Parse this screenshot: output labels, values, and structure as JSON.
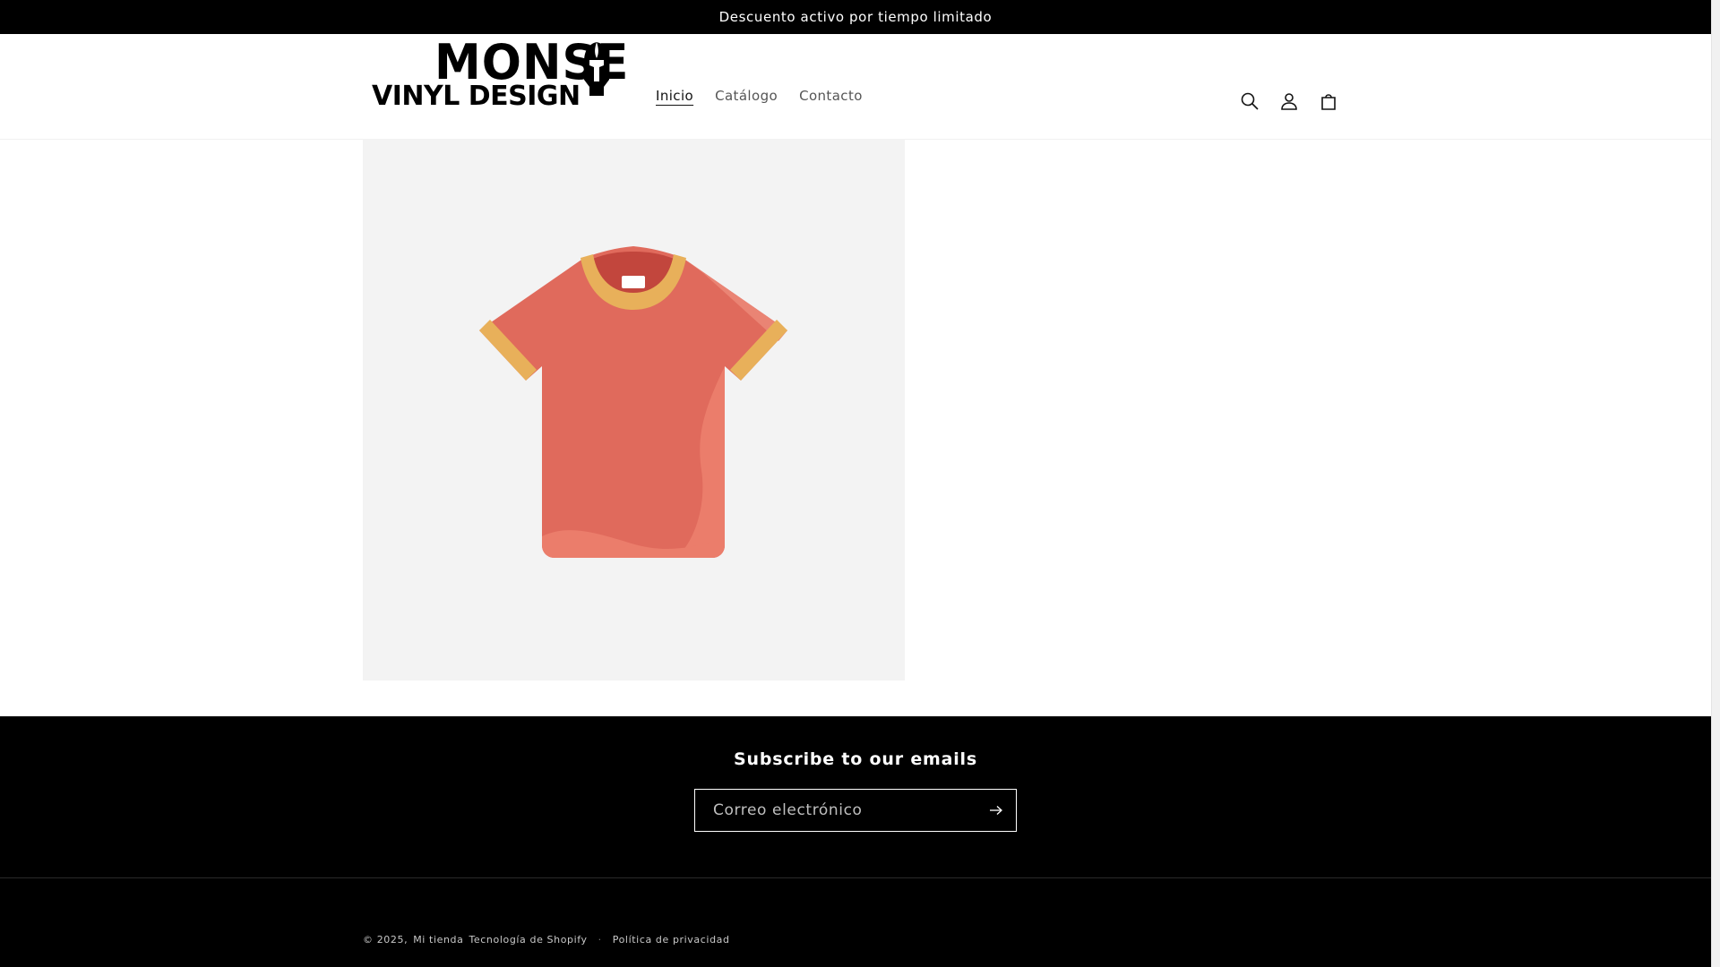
{
  "announcement": {
    "text": "Descuento activo por tiempo limitado"
  },
  "header": {
    "logo": {
      "line1": "MONSE",
      "line2": "VINYL DESIGN"
    },
    "nav": [
      {
        "label": "Inicio",
        "active": true
      },
      {
        "label": "Catálogo",
        "active": false
      },
      {
        "label": "Contacto",
        "active": false
      }
    ],
    "icons": [
      "search-icon",
      "account-icon",
      "cart-icon"
    ]
  },
  "product": {
    "image_icon": "t-shirt-placeholder-icon",
    "colors": {
      "shirt": "#E06A5C",
      "trim": "#E8B05A",
      "background": "#F3F3F3"
    }
  },
  "newsletter": {
    "title": "Subscribe to our emails",
    "email_placeholder": "Correo electrónico",
    "email_value": ""
  },
  "footer": {
    "copyright_prefix": "© 2025,",
    "store_name": "Mi tienda",
    "powered_by": "Tecnología de Shopify",
    "privacy_link": "Política de privacidad"
  },
  "colors": {
    "announcement_bg": "#000000",
    "footer_bg": "#000000",
    "text": "#121212"
  }
}
